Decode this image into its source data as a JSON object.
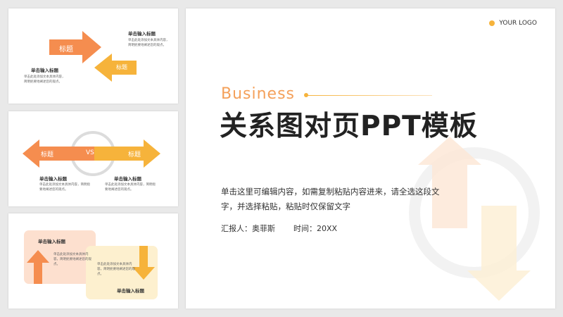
{
  "slide1": {
    "arrow1_label": "标题",
    "arrow2_label": "标题",
    "heading_right": "单击输入标题",
    "body_right": "单击此处添加文本具体内容，简明扼要地阐述您的观点。",
    "heading_left": "单击输入标题",
    "body_left": "单击此处添加文本具体内容，简明扼要地阐述您的观点。"
  },
  "slide2": {
    "left_label": "标题",
    "vs_label": "VS",
    "right_label": "标题",
    "heading_left": "单击输入标题",
    "body_left": "单击此处添加文本具体内容，简明扼要地阐述您的观点。",
    "heading_right": "单击输入标题",
    "body_right": "单击此处添加文本具体内容，简明扼要地阐述您的观点。"
  },
  "slide3": {
    "heading_top": "单击输入标题",
    "body_middle": "单击此处添加文本具体内容，简明扼要地阐述您的观点。",
    "body_right": "单击此处添加文本具体内容，简明扼要地阐述您的观点。",
    "heading_bottom": "单击输入标题"
  },
  "main": {
    "logo_text": "YOUR LOGO",
    "kicker": "Business",
    "title": "关系图对页PPT模板",
    "description": "单击这里可编辑内容，如需复制粘贴内容进来，请全选这段文字，并选择粘贴，粘贴时仅保留文字",
    "reporter": "汇报人：奥菲斯",
    "time": "时间：20XX"
  },
  "colors": {
    "orange": "#f58d4f",
    "yellow": "#f6b33b",
    "light_orange": "#fde0cf",
    "light_yellow": "#fdf0cf",
    "ring_gray": "#dcdcdc"
  }
}
